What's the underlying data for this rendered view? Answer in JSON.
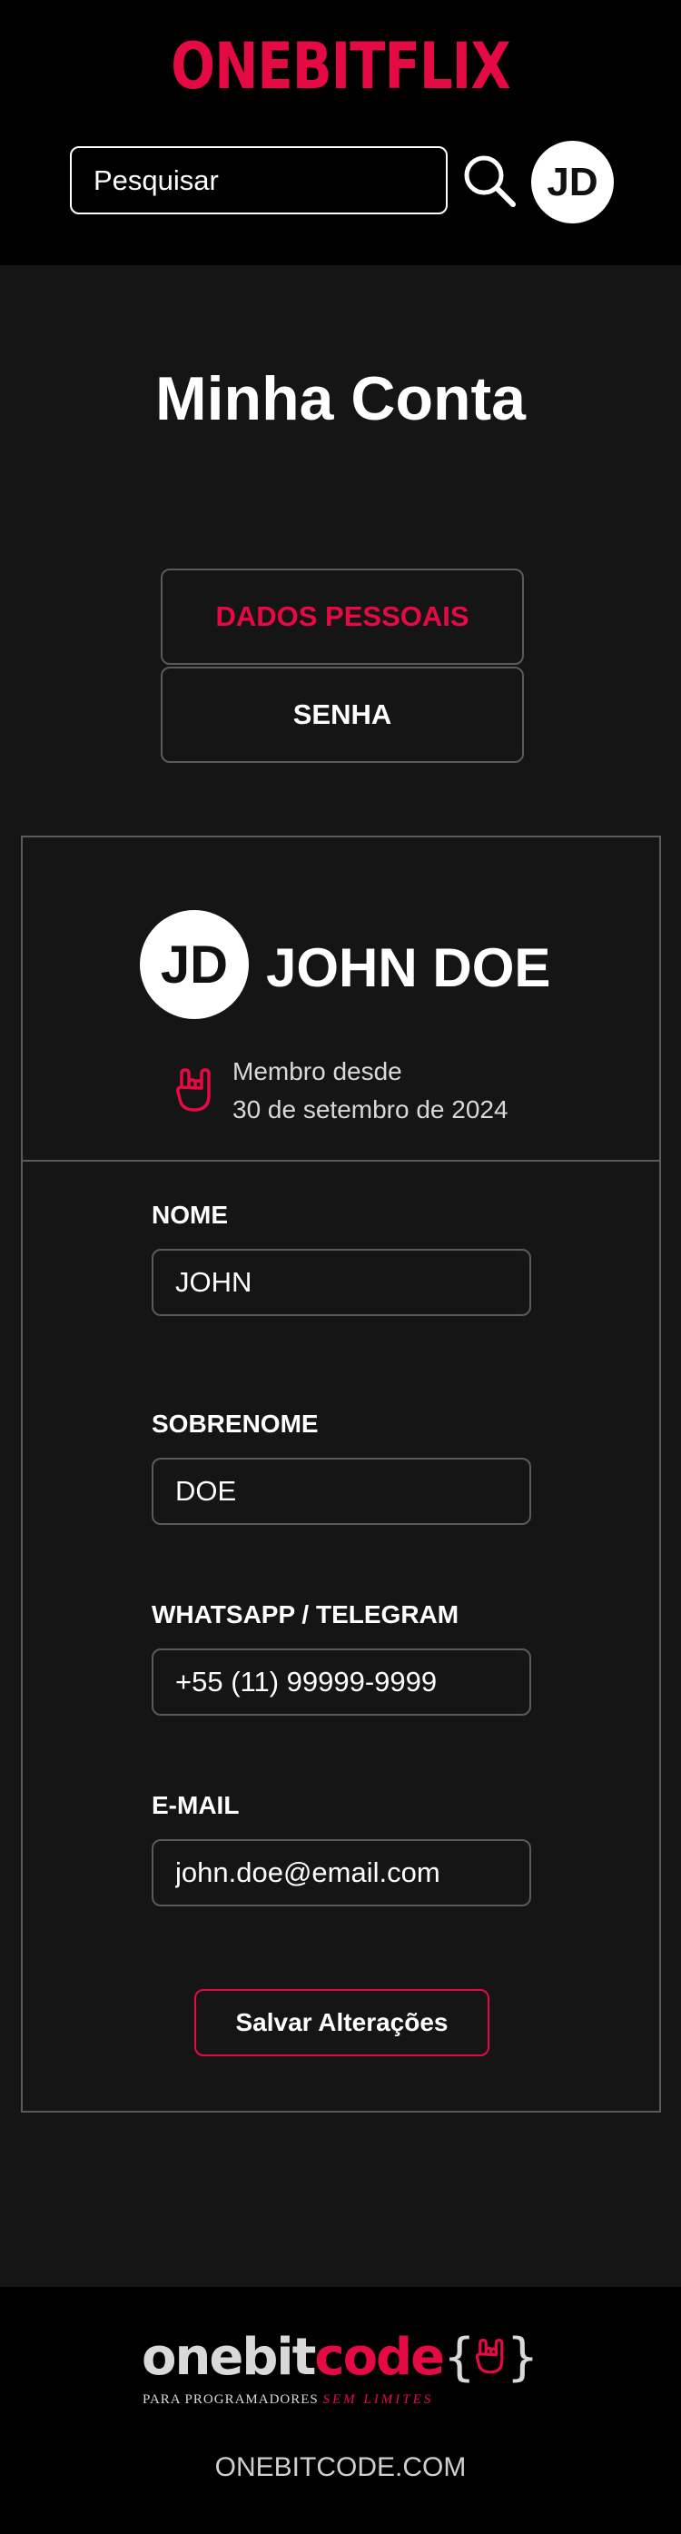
{
  "header": {
    "logo": "ONEBITFLIX",
    "search_placeholder": "Pesquisar",
    "avatar_initials": "JD"
  },
  "page": {
    "title": "Minha Conta"
  },
  "tabs": [
    {
      "label": "DADOS PESSOAIS",
      "active": true
    },
    {
      "label": "SENHA",
      "active": false
    }
  ],
  "profile": {
    "initials": "JD",
    "name": "JOHN DOE",
    "member_since_label": "Membro desde",
    "member_since_date": "30 de setembro de 2024"
  },
  "form": {
    "fields": [
      {
        "label": "NOME",
        "value": "JOHN"
      },
      {
        "label": "SOBRENOME",
        "value": "DOE"
      },
      {
        "label": "WHATSAPP / TELEGRAM",
        "value": "+55 (11) 99999-9999"
      },
      {
        "label": "E-MAIL",
        "value": "john.doe@email.com"
      }
    ],
    "save_label": "Salvar Alterações"
  },
  "footer": {
    "logo_one": "onebit",
    "logo_code": "code",
    "tagline": "PARA PROGRAMADORES",
    "tagline_accent": "SEM LIMITES",
    "link": "ONEBITCODE.COM"
  },
  "colors": {
    "accent": "#e50a44",
    "background": "#151515",
    "header_bg": "#000000",
    "border": "#5a5a5a"
  },
  "icons": {
    "search": "search-icon",
    "rock_hand": "rock-hand-icon"
  }
}
